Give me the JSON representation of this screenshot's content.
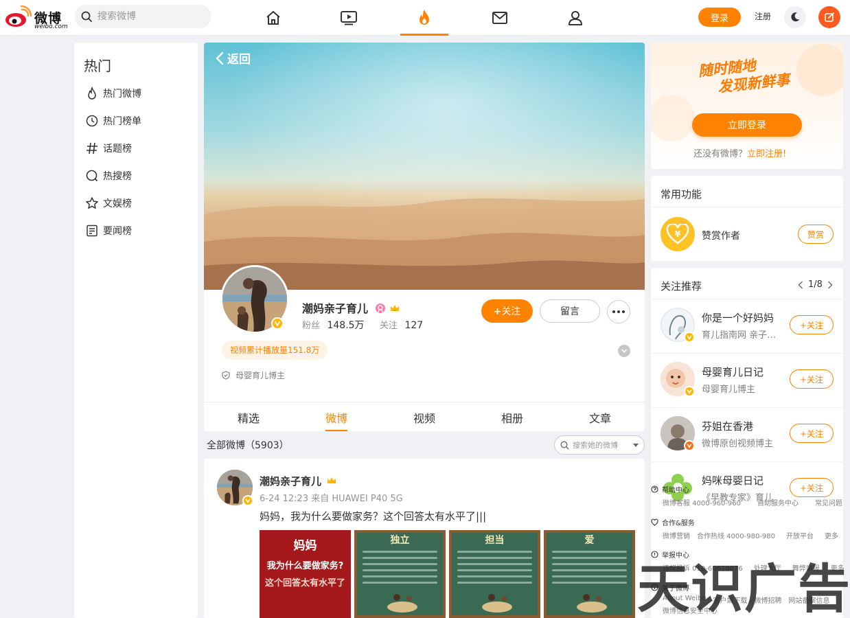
{
  "brand": {
    "name": "微博",
    "sub": "weibo.com"
  },
  "search": {
    "placeholder": "搜索微博"
  },
  "topbar": {
    "login_label": "登录",
    "register_label": "注册"
  },
  "sidebar": {
    "title": "热门",
    "items": [
      {
        "label": "热门微博",
        "icon": "flame-icon"
      },
      {
        "label": "热门榜单",
        "icon": "clock-icon"
      },
      {
        "label": "话题榜",
        "icon": "hashtag-icon"
      },
      {
        "label": "热搜榜",
        "icon": "search-ring-icon"
      },
      {
        "label": "文娱榜",
        "icon": "star-icon"
      },
      {
        "label": "要闻榜",
        "icon": "news-icon"
      }
    ]
  },
  "profile": {
    "back_label": "返回",
    "name": "潮妈亲子育儿",
    "fans_label": "粉丝",
    "fans": "148.5万",
    "follow_label": "关注",
    "following": "127",
    "follow_button": "关注",
    "message_button": "留言",
    "play_count": "视频累计播放量151.8万",
    "role": "母婴育儿博主",
    "tabs": [
      "精选",
      "微博",
      "视频",
      "相册",
      "文章"
    ],
    "active_tab": "微博"
  },
  "feed": {
    "header": "全部微博（5903）",
    "search_placeholder": "搜索她的微博",
    "post": {
      "author": "潮妈亲子育儿",
      "meta": "6-24 12:23  来自 HUAWEI P40 5G",
      "text": "妈妈，我为什么要做家务？这个回答太有水平了|||",
      "thumb1": {
        "line1": "妈妈",
        "line2": "我为什么要做家务?",
        "line3": "这个回答太有水平了"
      },
      "thumb_titles": [
        "独立",
        "担当",
        "爱"
      ]
    }
  },
  "login_card": {
    "slogan_line1": "随时随地",
    "slogan_line2": "发现新鲜事",
    "button": "立即登录",
    "no_account": "还没有微博？",
    "register_link": "立即注册!"
  },
  "functions": {
    "title": "常用功能",
    "reward_label": "赞赏作者",
    "reward_button": "赞赏"
  },
  "recommend": {
    "title": "关注推荐",
    "pager": "1/8",
    "follow_button": "关注",
    "items": [
      {
        "name": "你是一个好妈妈",
        "desc": "育儿指南网 亲子育儿"
      },
      {
        "name": "母婴育儿日记",
        "desc": "母婴育儿博主"
      },
      {
        "name": "芬姐在香港",
        "desc": "微博原创视频博主"
      },
      {
        "name": "妈咪母婴日记",
        "desc": "《早教专家》育儿"
      }
    ]
  },
  "footer": {
    "help": "帮助中心",
    "help_links": [
      "微博客服 4000-960-960",
      "自助服务中心",
      "常见问题"
    ],
    "coop": "合作&服务",
    "coop_links": [
      "微博营销",
      "合作热线 4000-980-980",
      "开放平台",
      "更多"
    ],
    "report": "举报中心",
    "report_links": [
      "违规投诉 010-60618076",
      "处理大厅",
      "舞弊举报",
      "更多"
    ],
    "about": "关于微博",
    "about_links": [
      "About Weibo",
      "客户端下载",
      "微博招聘",
      "网站备案信息"
    ],
    "about_links2": [
      "微博信息安全中心"
    ]
  },
  "watermark": "天识广告",
  "colors": {
    "accent": "#ff8200",
    "background": "#f0f1f4"
  }
}
